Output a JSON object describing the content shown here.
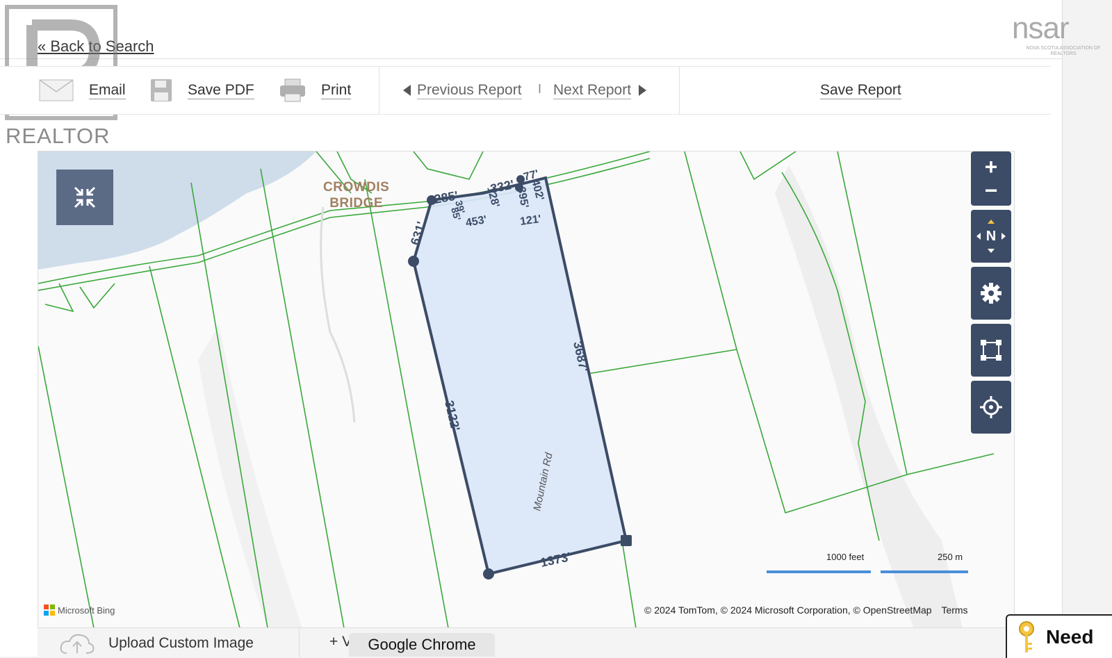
{
  "header": {
    "back_link": "« Back to Search",
    "brand_left": "REALTOR",
    "brand_right": "nsar",
    "brand_right_sub": "NOVA SCOTIA ASSOCIATION OF REALTORS"
  },
  "toolbar": {
    "email_label": "Email",
    "save_pdf_label": "Save PDF",
    "print_label": "Print",
    "previous_label": "Previous Report",
    "divider": "I",
    "next_label": "Next Report",
    "save_report_label": "Save Report"
  },
  "map": {
    "town_label_line1": "CROWDIS",
    "town_label_line2": "BRIDGE",
    "road_label": "Mountain Rd",
    "dimensions": {
      "d285": "285'",
      "d39": "39'",
      "d332": "332'",
      "d77": "77'",
      "d402": "402'",
      "d128": "128'",
      "d395": "395'",
      "d121": "121'",
      "d85": "85'",
      "d453": "453'",
      "d631": "631'",
      "d3687": "3687'",
      "d3122": "3122'",
      "d1373": "1373'"
    },
    "scale_feet": "1000 feet",
    "scale_meters": "250 m",
    "attribution": "© 2024 TomTom, © 2024 Microsoft Corporation, © OpenStreetMap",
    "terms": "Terms",
    "provider": "Microsoft Bing",
    "controls": {
      "zoom_in": "+",
      "zoom_out": "−",
      "compass": "N"
    },
    "colors": {
      "water": "#cfdcea",
      "parcel_fill": "#d9e6f8",
      "parcel_stroke": "#3c4c67",
      "lot_lines": "#3aa83a",
      "control_bg": "#3c4c67",
      "scale_bar": "#4a8fd8"
    }
  },
  "bottom": {
    "upload_label": "Upload Custom Image",
    "partial_label": "+ V",
    "tooltip": "Google Chrome",
    "help_label": "Need"
  }
}
